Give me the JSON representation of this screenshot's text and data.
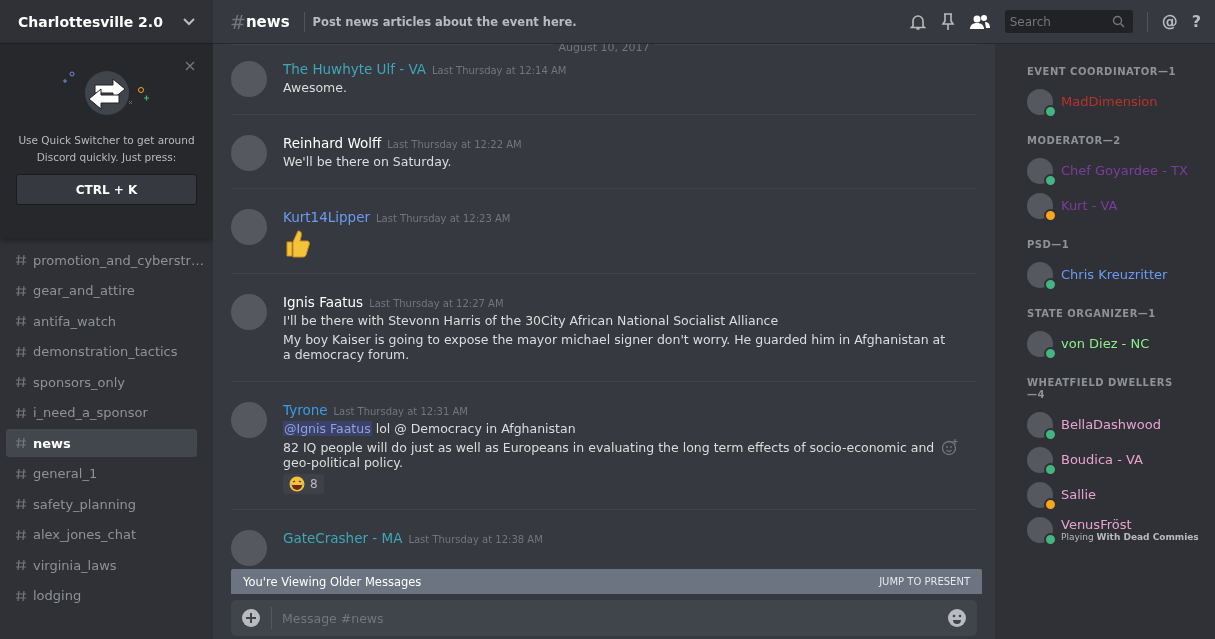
{
  "server": {
    "name": "Charlottesville 2.0"
  },
  "quick_switcher": {
    "text": "Use Quick Switcher to get around Discord quickly. Just press:",
    "shortcut": "CTRL + K"
  },
  "channels": [
    {
      "name": "promotion_and_cyberstr…",
      "selected": false
    },
    {
      "name": "gear_and_attire",
      "selected": false
    },
    {
      "name": "antifa_watch",
      "selected": false
    },
    {
      "name": "demonstration_tactics",
      "selected": false
    },
    {
      "name": "sponsors_only",
      "selected": false
    },
    {
      "name": "i_need_a_sponsor",
      "selected": false
    },
    {
      "name": "news",
      "selected": true
    },
    {
      "name": "general_1",
      "selected": false
    },
    {
      "name": "safety_planning",
      "selected": false
    },
    {
      "name": "alex_jones_chat",
      "selected": false
    },
    {
      "name": "virginia_laws",
      "selected": false
    },
    {
      "name": "lodging",
      "selected": false
    }
  ],
  "header": {
    "hash": "#",
    "channel": "news",
    "topic": "Post news articles about the event here.",
    "search_placeholder": "Search",
    "mention_symbol": "@",
    "help_symbol": "?"
  },
  "date_divider": "August 10, 2017",
  "messages": [
    {
      "author": "The Huwhyte Ulf - VA",
      "color": "#3ea7b8",
      "time": "Last Thursday at 12:14 AM",
      "lines": [
        {
          "kind": "text",
          "text": "Awesome."
        }
      ]
    },
    {
      "author": "Reinhard Wolff",
      "color": "#ffffff",
      "time": "Last Thursday at 12:22 AM",
      "lines": [
        {
          "kind": "text",
          "text": "We'll be there on Saturday."
        }
      ]
    },
    {
      "author": "Kurt14Lipper",
      "color": "#6b9cf2",
      "time": "Last Thursday at 12:23 AM",
      "lines": [
        {
          "kind": "thumbs"
        }
      ]
    },
    {
      "author": "Ignis Faatus",
      "color": "#ffffff",
      "time": "Last Thursday at 12:27 AM",
      "lines": [
        {
          "kind": "text",
          "text": "I'll be there with Stevonn Harris of the 30City African National Socialist Alliance"
        },
        {
          "kind": "text",
          "text": "My boy Kaiser is going to expose the mayor michael signer don't worry. He guarded him in Afghanistan at a democracy forum."
        }
      ]
    },
    {
      "author": "Tyrone",
      "color": "#3a9ce8",
      "time": "Last Thursday at 12:31 AM",
      "lines": [
        {
          "kind": "mention",
          "mention": "@Ignis Faatus",
          "text": " lol @ Democracy in Afghanistan"
        },
        {
          "kind": "text",
          "text": "82 IQ people will do just as well as Europeans in evaluating the long term effects of socio-economic and geo-political policy."
        }
      ],
      "reactions": [
        {
          "count": "8"
        }
      ]
    },
    {
      "author": "GateCrasher - MA",
      "color": "#3ea7b8",
      "time": "Last Thursday at 12:38 AM"
    }
  ],
  "older_banner": {
    "text": "You're Viewing Older Messages",
    "action": "JUMP TO PRESENT"
  },
  "composer": {
    "placeholder": "Message #news"
  },
  "member_groups": [
    {
      "role": "EVENT COORDINATOR—1",
      "members": [
        {
          "name": "MadDimension",
          "color": "#b8332b",
          "idle": false
        }
      ]
    },
    {
      "role": "MODERATOR—2",
      "members": [
        {
          "name": "Chef Goyardee - TX",
          "color": "#7a3e9d",
          "idle": false
        },
        {
          "name": "Kurt - VA",
          "color": "#7a3e9d",
          "idle": true
        }
      ]
    },
    {
      "role": "PSD—1",
      "members": [
        {
          "name": "Chris Kreuzritter",
          "color": "#6b9cf2",
          "idle": false
        }
      ]
    },
    {
      "role": "STATE ORGANIZER—1",
      "members": [
        {
          "name": "von Diez - NC",
          "color": "#8ef08a",
          "idle": false
        }
      ]
    },
    {
      "role": "WHEATFIELD DWELLERS—4",
      "members": [
        {
          "name": "BellaDashwood",
          "color": "#e8a4d0",
          "idle": false
        },
        {
          "name": "Boudica - VA",
          "color": "#e8a4d0",
          "idle": false
        },
        {
          "name": "Sallie",
          "color": "#e8a4d0",
          "idle": true
        },
        {
          "name": "VenusFröst",
          "color": "#e8a4d0",
          "idle": false,
          "activity": "Playing **With Dead Commies**"
        }
      ]
    }
  ]
}
